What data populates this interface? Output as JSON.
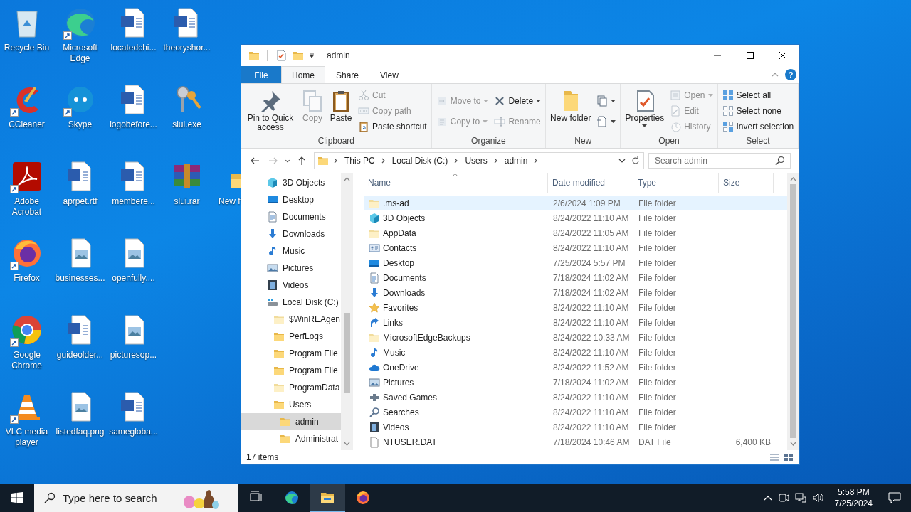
{
  "desktop": {
    "columns": [
      [
        {
          "label": "Recycle Bin",
          "kind": "recycle",
          "shortcut": false
        },
        {
          "label": "CCleaner",
          "kind": "ccleaner",
          "shortcut": true
        },
        {
          "label": "Adobe Acrobat",
          "kind": "acrobat",
          "shortcut": true
        },
        {
          "label": "Firefox",
          "kind": "firefox",
          "shortcut": true
        },
        {
          "label": "Google Chrome",
          "kind": "chrome",
          "shortcut": true
        },
        {
          "label": "VLC media player",
          "kind": "vlc",
          "shortcut": true
        }
      ],
      [
        {
          "label": "Microsoft Edge",
          "kind": "edge",
          "shortcut": true
        },
        {
          "label": "Skype",
          "kind": "skype",
          "shortcut": true
        },
        {
          "label": "aprpet.rtf",
          "kind": "word",
          "shortcut": false
        },
        {
          "label": "businesses...",
          "kind": "image",
          "shortcut": false
        },
        {
          "label": "guideolder...",
          "kind": "word",
          "shortcut": false
        },
        {
          "label": "listedfaq.png",
          "kind": "image",
          "shortcut": false
        }
      ],
      [
        {
          "label": "locatedchi...",
          "kind": "word",
          "shortcut": false
        },
        {
          "label": "logobefore...",
          "kind": "word",
          "shortcut": false
        },
        {
          "label": "membere...",
          "kind": "word",
          "shortcut": false
        },
        {
          "label": "openfully....",
          "kind": "image",
          "shortcut": false
        },
        {
          "label": "picturesop...",
          "kind": "image",
          "shortcut": false
        },
        {
          "label": "samegloba...",
          "kind": "word",
          "shortcut": false
        }
      ],
      [
        {
          "label": "theoryshor...",
          "kind": "word",
          "shortcut": false
        },
        {
          "label": "slui.exe",
          "kind": "keys",
          "shortcut": false
        },
        {
          "label": "slui.rar",
          "kind": "winrar",
          "shortcut": false
        }
      ],
      [
        {
          "label": "New f",
          "kind": "folder",
          "shortcut": false
        }
      ]
    ]
  },
  "explorer": {
    "title": "admin",
    "quick_access": [
      {
        "kind": "properties"
      },
      {
        "kind": "folder"
      }
    ],
    "ribbon_tabs": [
      {
        "label": "File",
        "kind": "file",
        "selected": false
      },
      {
        "label": "Home",
        "kind": "tab",
        "selected": true
      },
      {
        "label": "Share",
        "kind": "tab",
        "selected": false
      },
      {
        "label": "View",
        "kind": "tab",
        "selected": false
      }
    ],
    "help_label": "?",
    "ribbon_groups": [
      {
        "name": "Clipboard",
        "columns": [
          {
            "kind": "large",
            "items": [
              {
                "label": "Pin to Quick access",
                "kind": "pin",
                "disabled": false,
                "dropdown": false
              }
            ]
          },
          {
            "kind": "large",
            "items": [
              {
                "label": "Copy",
                "kind": "copy",
                "disabled": true,
                "dropdown": false
              }
            ]
          },
          {
            "kind": "large",
            "items": [
              {
                "label": "Paste",
                "kind": "paste",
                "disabled": false,
                "dropdown": false
              }
            ]
          },
          {
            "kind": "small",
            "items": [
              {
                "label": "Cut",
                "kind": "cut",
                "disabled": true,
                "dropdown": false
              },
              {
                "label": "Copy path",
                "kind": "copypath",
                "disabled": true,
                "dropdown": false
              },
              {
                "label": "Paste shortcut",
                "kind": "pasteshortcut",
                "disabled": false,
                "dropdown": false
              }
            ]
          }
        ]
      },
      {
        "name": "Organize",
        "columns": [
          {
            "kind": "small",
            "items": [
              {
                "label": "Move to",
                "kind": "moveto",
                "disabled": true,
                "dropdown": true
              },
              {
                "label": "Copy to",
                "kind": "copyto",
                "disabled": true,
                "dropdown": true
              }
            ]
          },
          {
            "kind": "small",
            "items": [
              {
                "label": "Delete",
                "kind": "delete",
                "disabled": false,
                "dropdown": true
              },
              {
                "label": "Rename",
                "kind": "rename",
                "disabled": true,
                "dropdown": false
              }
            ]
          }
        ]
      },
      {
        "name": "New",
        "columns": [
          {
            "kind": "large",
            "items": [
              {
                "label": "New folder",
                "kind": "newfolder",
                "disabled": false,
                "dropdown": false
              }
            ]
          },
          {
            "kind": "small",
            "items": [
              {
                "kind": "newitem",
                "disabled": false,
                "dropdown": true
              },
              {
                "kind": "easyaccess",
                "disabled": false,
                "dropdown": true
              }
            ]
          }
        ]
      },
      {
        "name": "Open",
        "columns": [
          {
            "kind": "large",
            "items": [
              {
                "label": "Properties",
                "kind": "properties",
                "disabled": false,
                "dropdown": true
              }
            ]
          },
          {
            "kind": "small",
            "items": [
              {
                "label": "Open",
                "kind": "open",
                "disabled": true,
                "dropdown": true
              },
              {
                "label": "Edit",
                "kind": "edit",
                "disabled": true,
                "dropdown": false
              },
              {
                "label": "History",
                "kind": "history",
                "disabled": true,
                "dropdown": false
              }
            ]
          }
        ]
      },
      {
        "name": "Select",
        "columns": [
          {
            "kind": "small",
            "items": [
              {
                "label": "Select all",
                "kind": "selectall",
                "disabled": false,
                "dropdown": false
              },
              {
                "label": "Select none",
                "kind": "selectnone",
                "disabled": false,
                "dropdown": false
              },
              {
                "label": "Invert selection",
                "kind": "invert",
                "disabled": false,
                "dropdown": false
              }
            ]
          }
        ]
      }
    ],
    "nav_buttons": [
      {
        "kind": "back",
        "disabled": false
      },
      {
        "kind": "forward",
        "disabled": true
      },
      {
        "kind": "recent",
        "disabled": false
      },
      {
        "kind": "up",
        "disabled": false
      }
    ],
    "breadcrumbs": [
      "This PC",
      "Local Disk (C:)",
      "Users",
      "admin"
    ],
    "search_placeholder": "Search admin",
    "nav": [
      {
        "label": "3D Objects",
        "kind": "cube",
        "selected": false
      },
      {
        "label": "Desktop",
        "kind": "desktop",
        "selected": false
      },
      {
        "label": "Documents",
        "kind": "documents",
        "selected": false
      },
      {
        "label": "Downloads",
        "kind": "downloads",
        "selected": false
      },
      {
        "label": "Music",
        "kind": "music",
        "selected": false
      },
      {
        "label": "Pictures",
        "kind": "pictures",
        "selected": false
      },
      {
        "label": "Videos",
        "kind": "videos",
        "selected": false
      },
      {
        "label": "Local Disk (C:)",
        "kind": "disk",
        "selected": false,
        "children": [
          {
            "label": "$WinREAgen",
            "kind": "folderlight",
            "selected": false
          },
          {
            "label": "PerfLogs",
            "kind": "folder",
            "selected": false
          },
          {
            "label": "Program File",
            "kind": "folder",
            "selected": false
          },
          {
            "label": "Program File",
            "kind": "folder",
            "selected": false
          },
          {
            "label": "ProgramData",
            "kind": "folderlight",
            "selected": false
          },
          {
            "label": "Users",
            "kind": "folder",
            "selected": false,
            "children": [
              {
                "label": "admin",
                "kind": "folder",
                "selected": true
              },
              {
                "label": "Administrat",
                "kind": "folder",
                "selected": false
              }
            ]
          }
        ]
      }
    ],
    "columns": [
      {
        "label": "Name",
        "sorted": true
      },
      {
        "label": "Date modified",
        "sorted": false
      },
      {
        "label": "Type",
        "sorted": false
      },
      {
        "label": "Size",
        "sorted": false
      }
    ],
    "files": [
      {
        "name": ".ms-ad",
        "kind": "folderlight",
        "date": "2/6/2024 1:09 PM",
        "type": "File folder",
        "selected": true
      },
      {
        "name": "3D Objects",
        "kind": "cube",
        "date": "8/24/2022 11:10 AM",
        "type": "File folder",
        "selected": false
      },
      {
        "name": "AppData",
        "kind": "folderlight",
        "date": "8/24/2022 11:05 AM",
        "type": "File folder",
        "selected": false
      },
      {
        "name": "Contacts",
        "kind": "contacts",
        "date": "8/24/2022 11:10 AM",
        "type": "File folder",
        "selected": false
      },
      {
        "name": "Desktop",
        "kind": "desktop",
        "date": "7/25/2024 5:57 PM",
        "type": "File folder",
        "selected": false
      },
      {
        "name": "Documents",
        "kind": "documents",
        "date": "7/18/2024 11:02 AM",
        "type": "File folder",
        "selected": false
      },
      {
        "name": "Downloads",
        "kind": "downloads",
        "date": "7/18/2024 11:02 AM",
        "type": "File folder",
        "selected": false
      },
      {
        "name": "Favorites",
        "kind": "star",
        "date": "8/24/2022 11:10 AM",
        "type": "File folder",
        "selected": false
      },
      {
        "name": "Links",
        "kind": "links",
        "date": "8/24/2022 11:10 AM",
        "type": "File folder",
        "selected": false
      },
      {
        "name": "MicrosoftEdgeBackups",
        "kind": "folderlight",
        "date": "8/24/2022 10:33 AM",
        "type": "File folder",
        "selected": false
      },
      {
        "name": "Music",
        "kind": "music",
        "date": "8/24/2022 11:10 AM",
        "type": "File folder",
        "selected": false
      },
      {
        "name": "OneDrive",
        "kind": "onedrive",
        "date": "8/24/2022 11:52 AM",
        "type": "File folder",
        "selected": false
      },
      {
        "name": "Pictures",
        "kind": "pictures",
        "date": "7/18/2024 11:02 AM",
        "type": "File folder",
        "selected": false
      },
      {
        "name": "Saved Games",
        "kind": "games",
        "date": "8/24/2022 11:10 AM",
        "type": "File folder",
        "selected": false
      },
      {
        "name": "Searches",
        "kind": "searches",
        "date": "8/24/2022 11:10 AM",
        "type": "File folder",
        "selected": false
      },
      {
        "name": "Videos",
        "kind": "videos",
        "date": "8/24/2022 11:10 AM",
        "type": "File folder",
        "selected": false
      },
      {
        "name": "NTUSER.DAT",
        "kind": "file",
        "date": "7/18/2024 10:46 AM",
        "type": "DAT File",
        "size": "6,400 KB",
        "selected": false
      }
    ],
    "status": "17 items"
  },
  "taskbar": {
    "search_placeholder": "Type here to search",
    "apps": [
      {
        "kind": "taskview",
        "active": false
      },
      {
        "kind": "edge",
        "active": false
      },
      {
        "kind": "explorer",
        "active": true
      },
      {
        "kind": "firefox",
        "active": false
      }
    ],
    "time": "5:58 PM",
    "date": "7/25/2024"
  }
}
